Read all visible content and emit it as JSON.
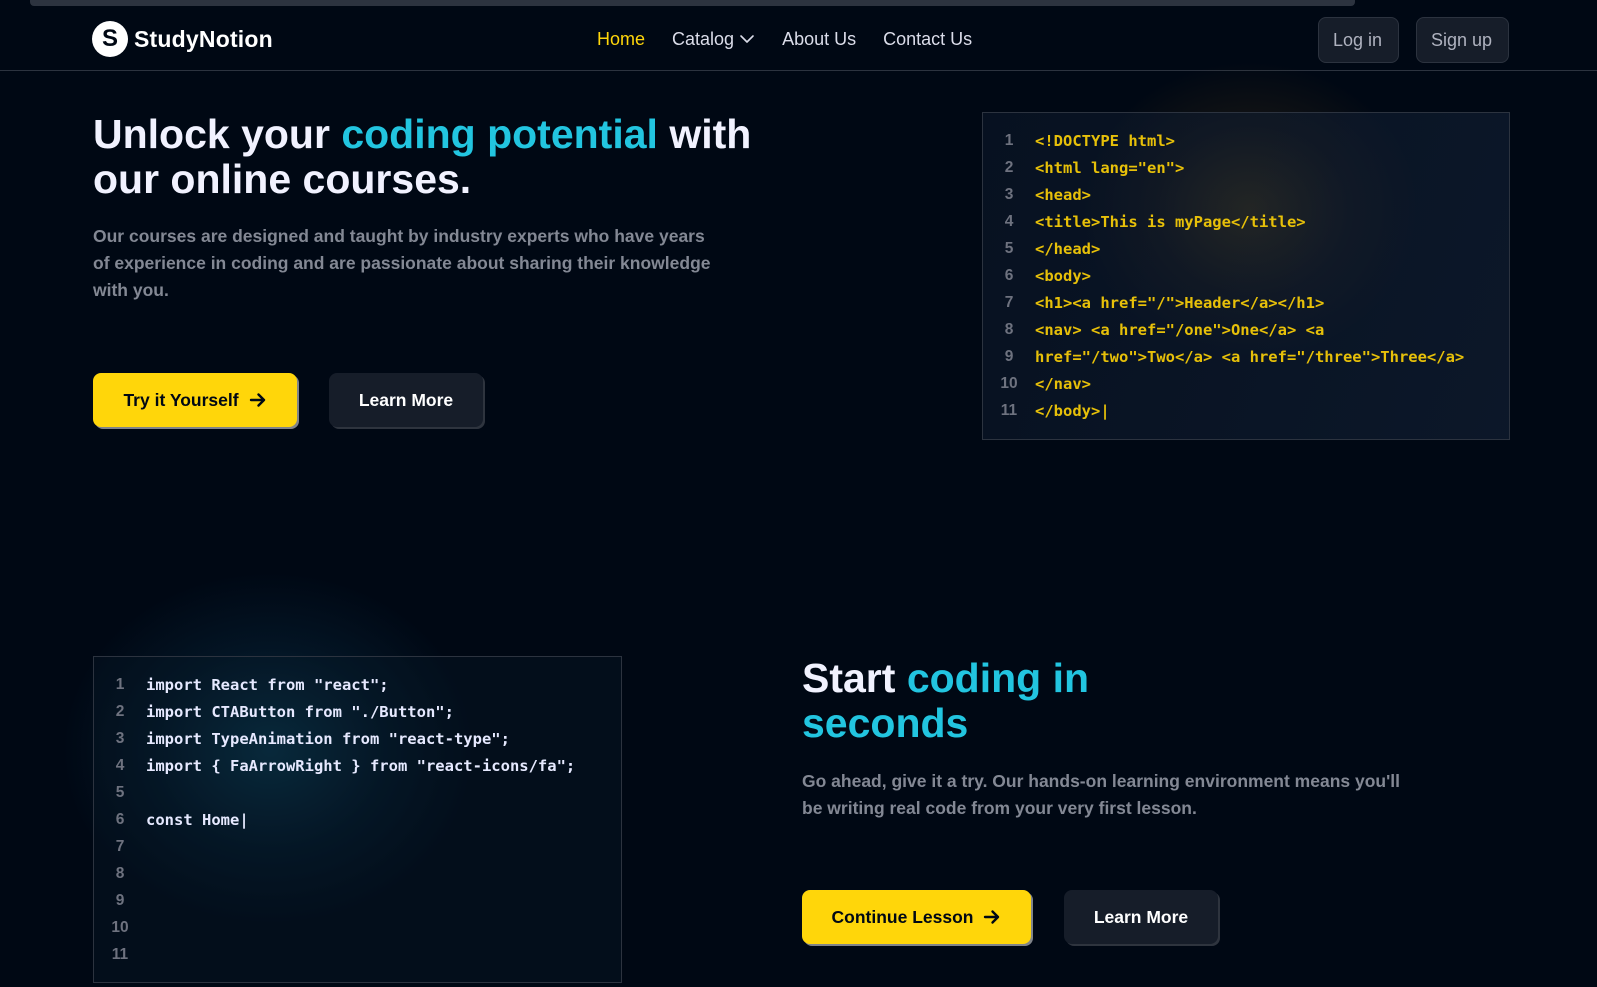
{
  "brand": {
    "name": "StudyNotion",
    "logo_letter": "S"
  },
  "nav": {
    "links": [
      {
        "label": "Home",
        "active": true
      },
      {
        "label": "Catalog",
        "dropdown": true
      },
      {
        "label": "About Us"
      },
      {
        "label": "Contact Us"
      }
    ],
    "login_label": "Log in",
    "signup_label": "Sign up"
  },
  "hero": {
    "heading_before": "Unlock your ",
    "heading_highlight": "coding potential",
    "heading_after": " with our online courses.",
    "subtext": "Our courses are designed and taught by industry experts who have years of experience in coding and are passionate about sharing their knowledge with you.",
    "primary_button": "Try it Yourself",
    "secondary_button": "Learn More"
  },
  "code_block_1": {
    "lines": [
      {
        "num": "1",
        "text": "<!DOCTYPE html>"
      },
      {
        "num": "2",
        "text": "<html lang=\"en\">"
      },
      {
        "num": "3",
        "text": "<head>"
      },
      {
        "num": "4",
        "text": "<title>This is myPage</title>"
      },
      {
        "num": "5",
        "text": "</head>"
      },
      {
        "num": "6",
        "text": "<body>"
      },
      {
        "num": "7",
        "text": "<h1><a href=\"/\">Header</a></h1>"
      },
      {
        "num": "8",
        "text": "<nav> <a href=\"/one\">One</a> <a"
      },
      {
        "num": "9",
        "text": "href=\"/two\">Two</a> <a href=\"/three\">Three</a>"
      },
      {
        "num": "10",
        "text": "</nav>"
      },
      {
        "num": "11",
        "text": "</body>|"
      }
    ]
  },
  "section2": {
    "heading_before": "Start ",
    "heading_highlight": "coding in seconds",
    "subtext": "Go ahead, give it a try. Our hands-on learning environment means you'll be writing real code from your very first lesson.",
    "primary_button": "Continue Lesson",
    "secondary_button": "Learn More"
  },
  "code_block_2": {
    "lines": [
      {
        "num": "1",
        "text": "import React from \"react\";"
      },
      {
        "num": "2",
        "text": "import CTAButton from \"./Button\";"
      },
      {
        "num": "3",
        "text": "import TypeAnimation from \"react-type\";"
      },
      {
        "num": "4",
        "text": "import { FaArrowRight } from \"react-icons/fa\";"
      },
      {
        "num": "5",
        "text": ""
      },
      {
        "num": "6",
        "text": "const Home|"
      },
      {
        "num": "7",
        "text": ""
      },
      {
        "num": "8",
        "text": ""
      },
      {
        "num": "9",
        "text": ""
      },
      {
        "num": "10",
        "text": ""
      },
      {
        "num": "11",
        "text": ""
      }
    ]
  },
  "colors": {
    "background": "#000814",
    "accent_yellow": "#ffd60a",
    "accent_cyan": "#22c5e0",
    "code_yellow": "#e7c009"
  }
}
